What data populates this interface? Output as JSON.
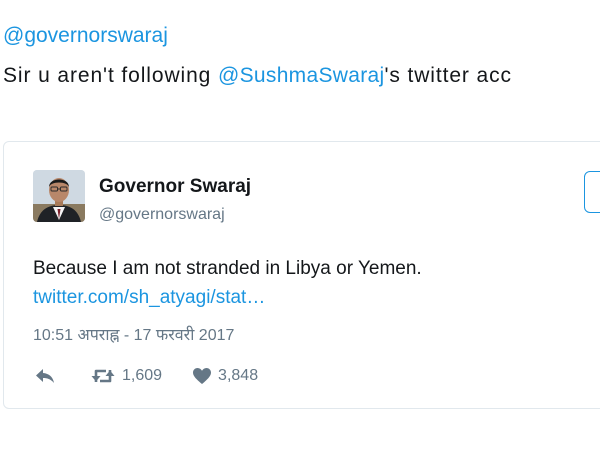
{
  "outer_tweet": {
    "reply_to": "@governorswaraj",
    "text_before": "Sir u aren't following ",
    "mention": "@SushmaSwaraj",
    "text_after": "'s twitter acc"
  },
  "quoted_tweet": {
    "display_name": "Governor Swaraj",
    "handle": "@governorswaraj",
    "text": "Because I am not stranded in Libya or Yemen.",
    "link": "twitter.com/sh_atyagi/stat…",
    "timestamp": "10:51 अपराह्न - 17 फरवरी 2017",
    "retweets": "1,609",
    "likes": "3,848"
  },
  "colors": {
    "link": "#1b95e0",
    "text": "#14171a",
    "muted": "#657786",
    "border": "#e1e8ed"
  },
  "icons": [
    "reply-icon",
    "retweet-icon",
    "heart-icon"
  ]
}
